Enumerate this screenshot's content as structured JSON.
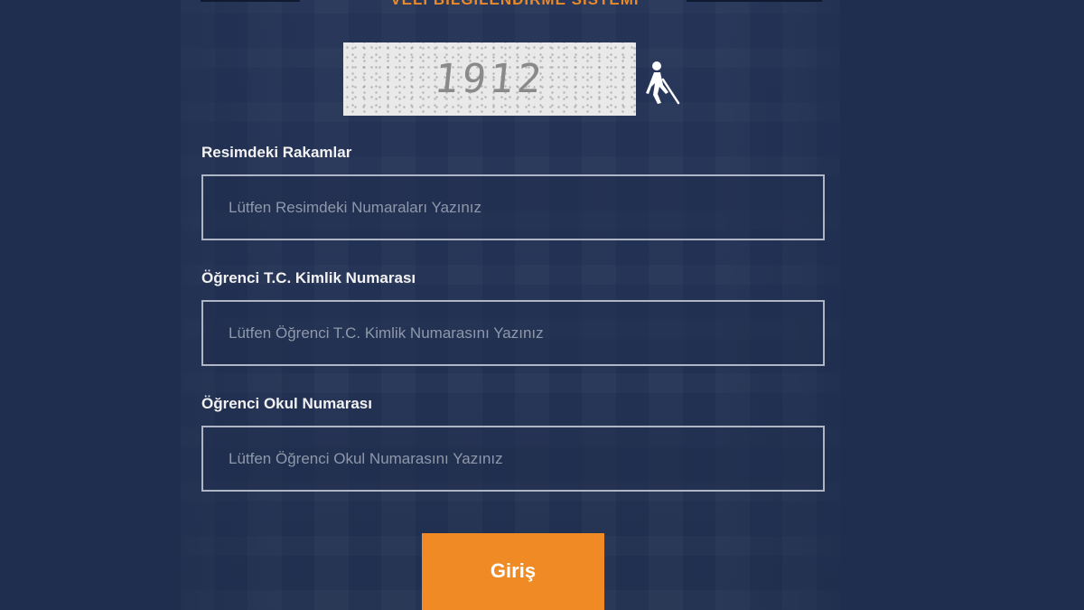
{
  "header": {
    "title": "VELİ BİLGİLENDİRME SİSTEMİ"
  },
  "captcha": {
    "code": "1912",
    "accessibility_icon": "wheelchair-accessibility-icon"
  },
  "form": {
    "fields": [
      {
        "label": "Resimdeki Rakamlar",
        "placeholder": "Lütfen Resimdeki Numaraları Yazınız",
        "value": ""
      },
      {
        "label": "Öğrenci T.C. Kimlik Numarası",
        "placeholder": "Lütfen Öğrenci T.C. Kimlik Numarasını Yazınız",
        "value": ""
      },
      {
        "label": "Öğrenci Okul Numarası",
        "placeholder": "Lütfen Öğrenci Okul Numarasını Yazınız",
        "value": ""
      }
    ],
    "submit_label": "Giriş"
  },
  "colors": {
    "background": "#1f2d4e",
    "accent": "#ef8a24",
    "input_border": "#aeb6c6"
  }
}
